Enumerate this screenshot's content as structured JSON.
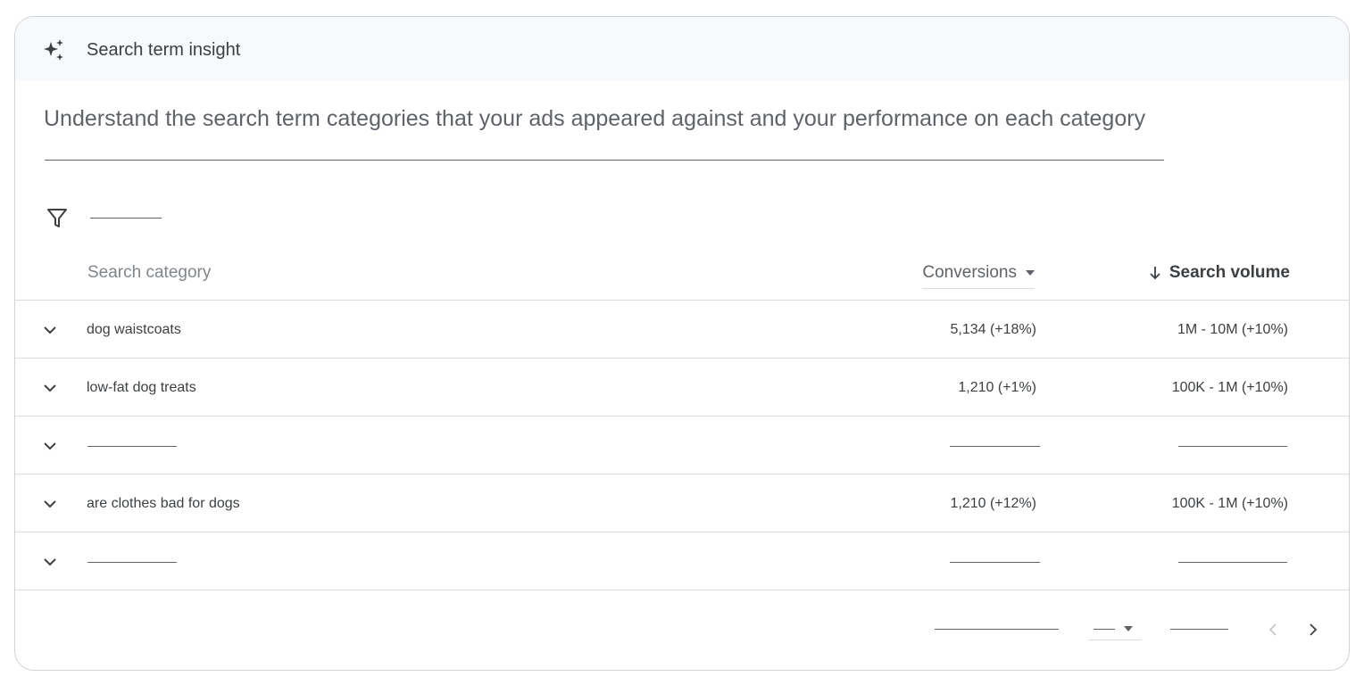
{
  "card": {
    "title": "Search term insight",
    "description": "Understand the search term categories that your ads appeared against and your performance on each category"
  },
  "icons": {
    "header": "sparkle-icon",
    "filter": "filter-icon",
    "expand": "chevron-down-icon",
    "sort": "arrow-down-icon",
    "prev": "chevron-left-icon",
    "next": "chevron-right-icon"
  },
  "table": {
    "headers": {
      "category": "Search category",
      "conversions": "Conversions",
      "volume": "Search volume"
    },
    "rows": [
      {
        "category": "dog waistcoats",
        "conversions": "5,134 (+18%)",
        "volume": "1M - 10M (+10%)"
      },
      {
        "category": "low-fat dog treats",
        "conversions": "1,210 (+1%)",
        "volume": "100K - 1M (+10%)"
      },
      {
        "category": "",
        "conversions": "",
        "volume": ""
      },
      {
        "category": "are clothes bad for dogs",
        "conversions": "1,210 (+12%)",
        "volume": "100K - 1M (+10%)"
      },
      {
        "category": "",
        "conversions": "",
        "volume": ""
      }
    ]
  },
  "colors": {
    "header_bg": "#f7f9fc",
    "border": "#dadce0",
    "text": "#3c4043",
    "muted": "#80868b"
  }
}
